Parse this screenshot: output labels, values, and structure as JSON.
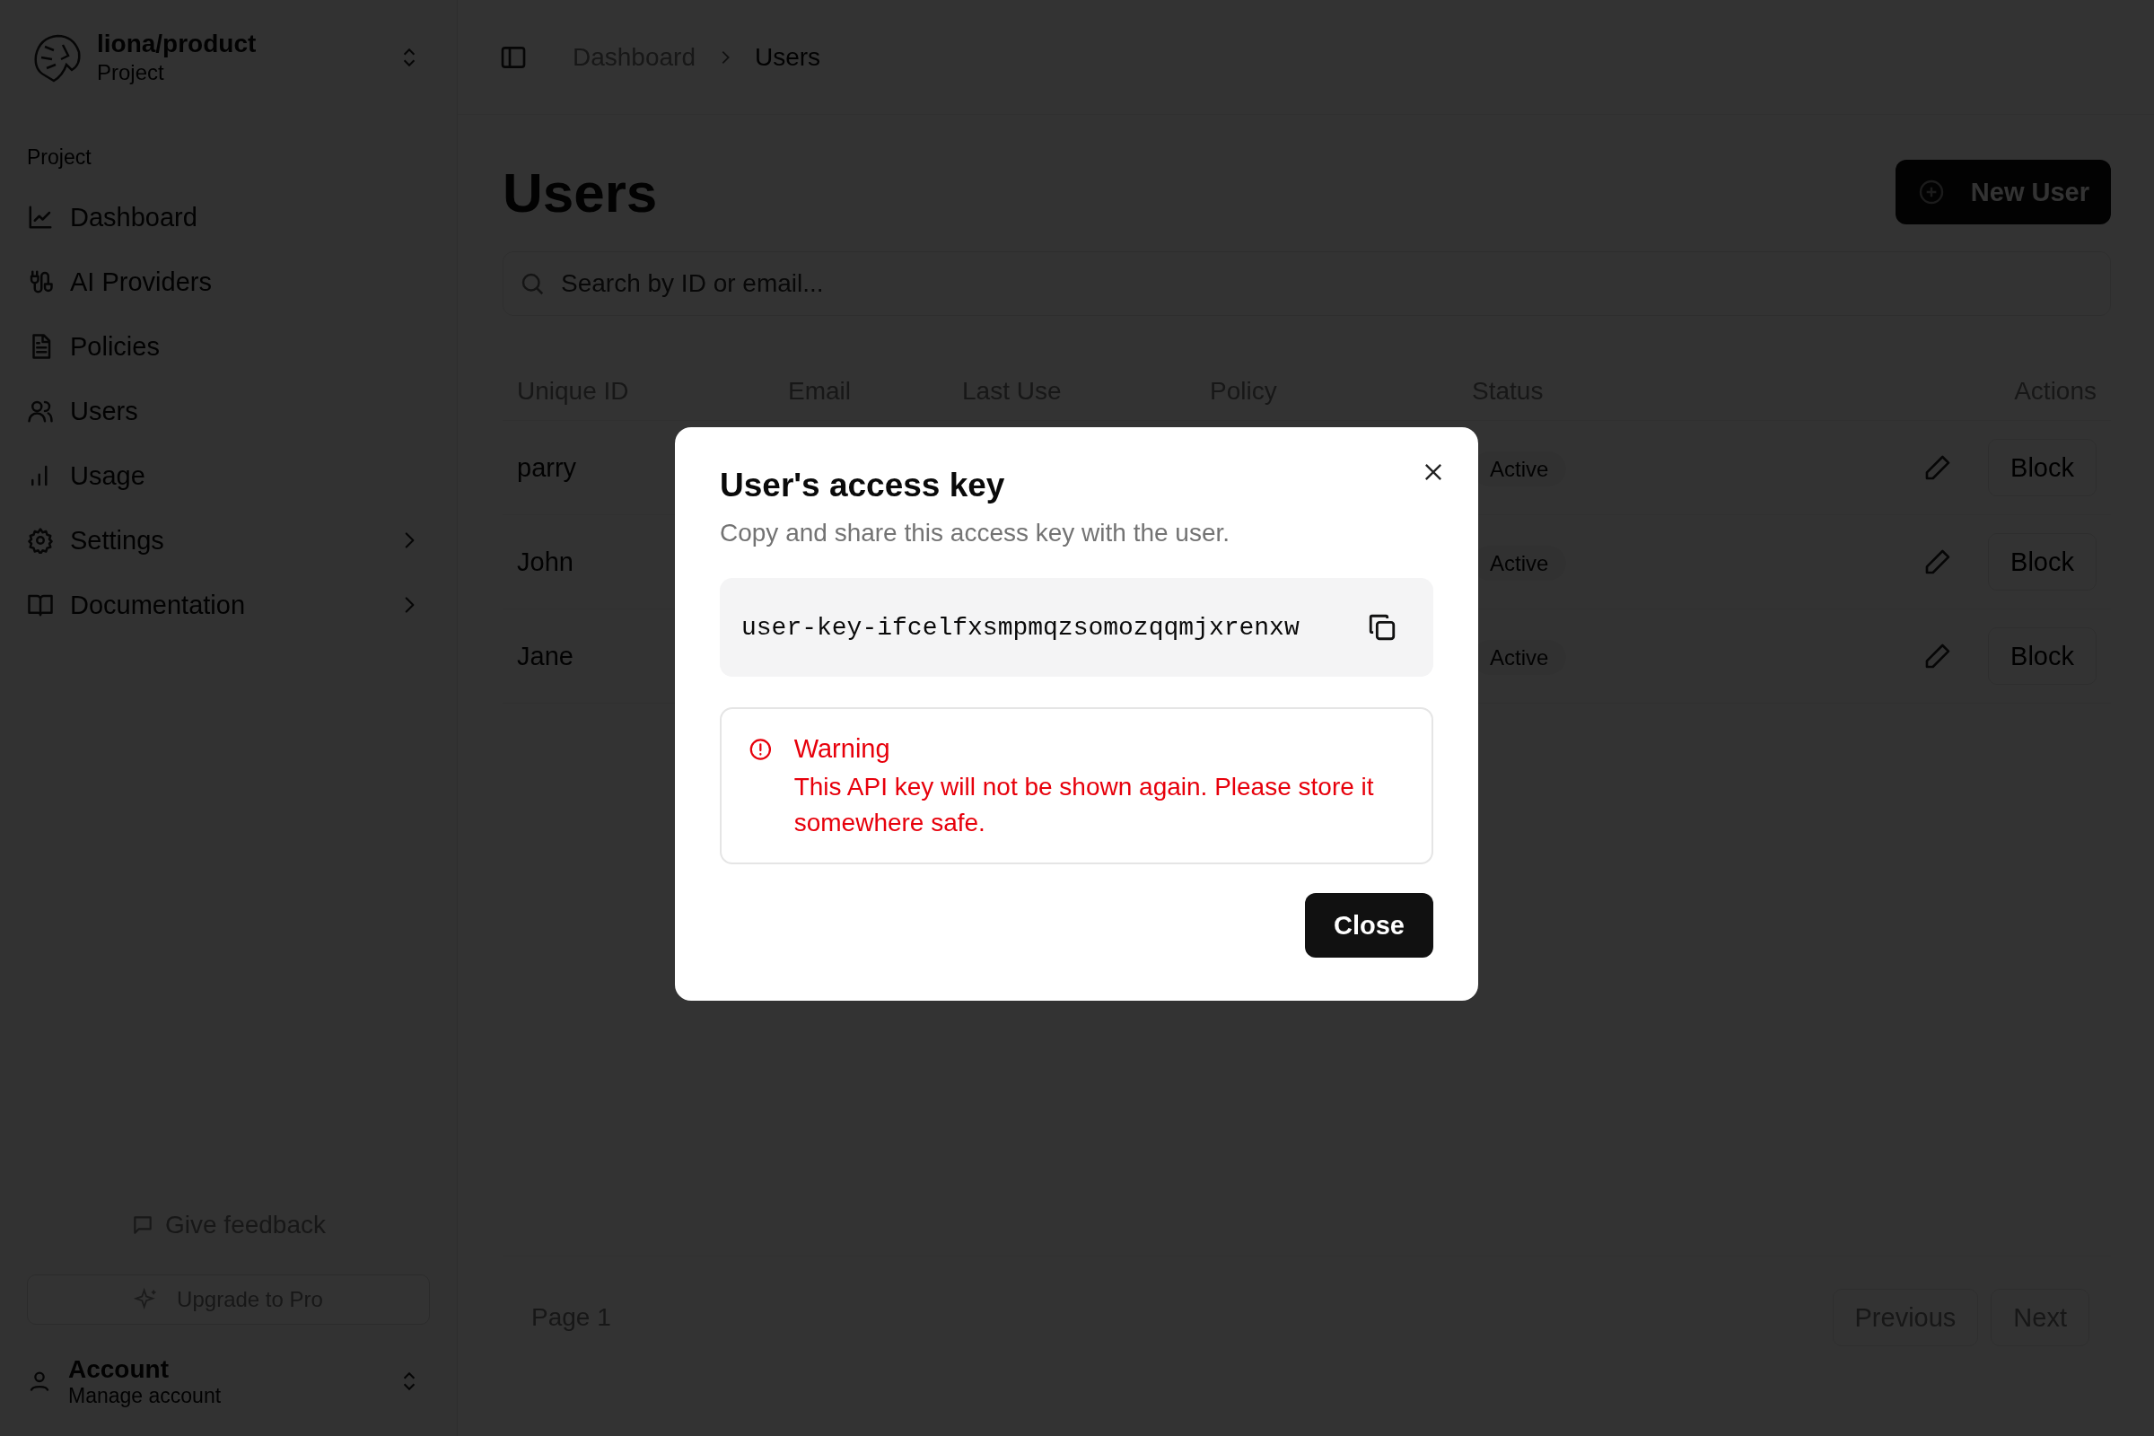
{
  "sidebar": {
    "project": {
      "name": "liona/product",
      "subtitle": "Project"
    },
    "section_label": "Project",
    "items": [
      {
        "label": "Dashboard",
        "has_submenu": false
      },
      {
        "label": "AI Providers",
        "has_submenu": false
      },
      {
        "label": "Policies",
        "has_submenu": false
      },
      {
        "label": "Users",
        "has_submenu": false
      },
      {
        "label": "Usage",
        "has_submenu": false
      },
      {
        "label": "Settings",
        "has_submenu": true
      },
      {
        "label": "Documentation",
        "has_submenu": true
      }
    ],
    "feedback": "Give feedback",
    "upgrade": "Upgrade to Pro",
    "account": {
      "title": "Account",
      "subtitle": "Manage account"
    }
  },
  "breadcrumb": [
    {
      "label": "Dashboard",
      "current": false
    },
    {
      "label": "Users",
      "current": true
    }
  ],
  "page_title": "Users",
  "new_user_button": "New User",
  "search": {
    "placeholder": "Search by ID or email..."
  },
  "table": {
    "columns": [
      "Unique ID",
      "Email",
      "Last Use",
      "Policy",
      "Status",
      "Actions"
    ],
    "rows": [
      {
        "unique_id": "parry",
        "status": "Active",
        "action": "Block"
      },
      {
        "unique_id": "John",
        "status": "Active",
        "action": "Block"
      },
      {
        "unique_id": "Jane",
        "status": "Active",
        "action": "Block"
      }
    ]
  },
  "pagination": {
    "page": "Page 1",
    "previous": "Previous",
    "next": "Next"
  },
  "modal": {
    "title": "User's access key",
    "description": "Copy and share this access key with the user.",
    "key": "user-key-ifcelfxsmpmqzsomozqqmjxrenxw",
    "warning": {
      "title": "Warning",
      "message": "This API key will not be shown again. Please store it somewhere safe."
    },
    "close_button": "Close"
  }
}
